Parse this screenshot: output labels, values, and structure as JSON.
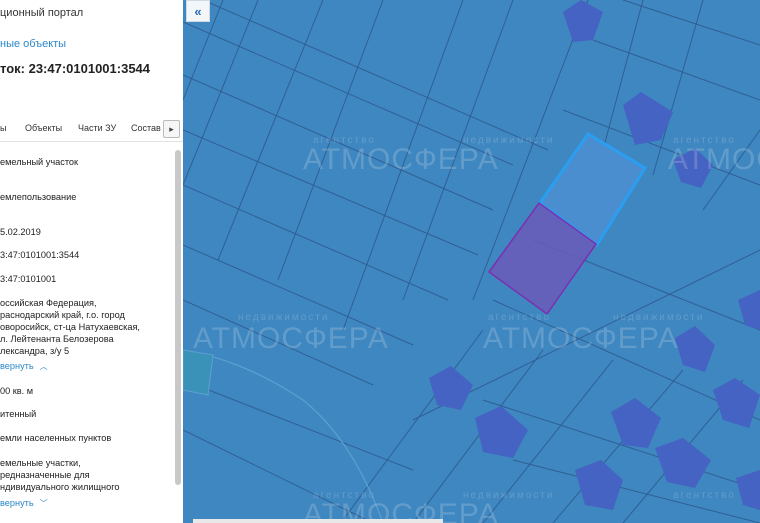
{
  "panel": {
    "portal_title": "ционный портал",
    "objects_link": "ные объекты",
    "plot_title": "ток: 23:47:0101001:3544",
    "tabs": [
      "ы",
      "Объекты",
      "Части ЗУ",
      "Состав"
    ],
    "tab_more_icon": "chevron-right-icon",
    "attributes": [
      "емельный участок",
      "емлепользование",
      "5.02.2019",
      "3:47:0101001:3544",
      "3:47:0101001",
      "оссийская Федерация,",
      "раснодарский край, г.о. город",
      "оворосийск, ст-ца Натухаевская,",
      "л. Лейтенанта Белозерова",
      "лександра, з/у 5",
      "00 кв. м",
      "итенный",
      "емли населенных пунктов",
      "емельные участки,",
      "редназначенные для",
      "ндивидуального жилищного"
    ],
    "collapse_link": "вернуть",
    "expand_link": "вернуть"
  },
  "map": {
    "collapse_icon": "«",
    "watermark_small": "агентство",
    "watermark_small2": "недвижимости",
    "watermark_big": "АТМОСФЕРА",
    "colors": {
      "background": "#3f87c0",
      "parcel_line": "#2f5f94",
      "selected_parcel_fill": "#6a5bb8",
      "selected_parcel_stroke": "#7b2fb0",
      "highlighted_parcel_stroke": "#2a9ef0",
      "building": "#4563c2"
    }
  }
}
